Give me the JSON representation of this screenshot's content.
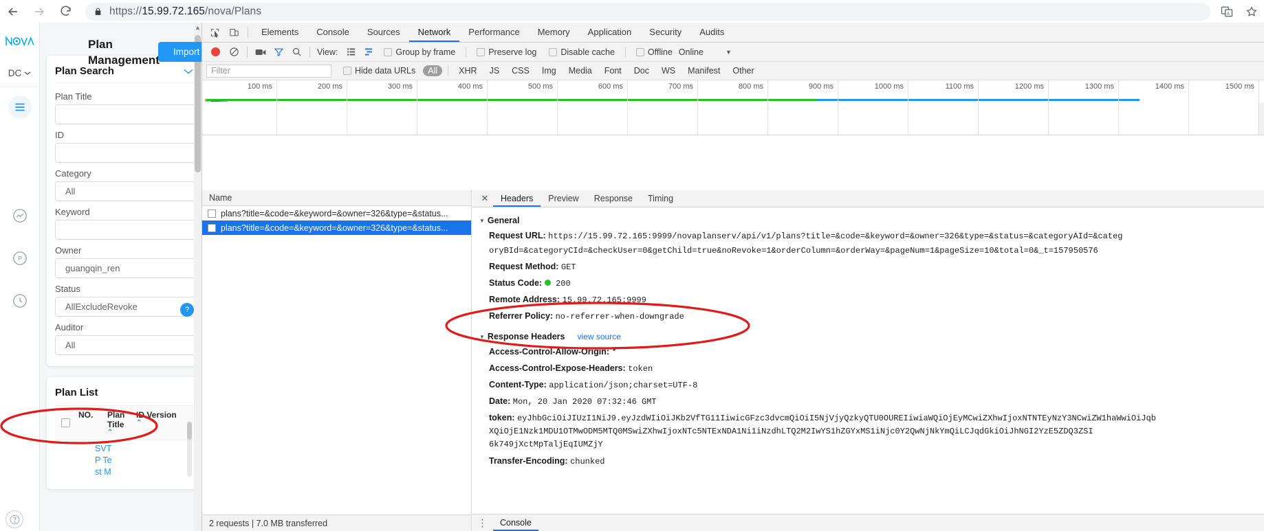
{
  "browser": {
    "back_icon": "back-arrow-icon",
    "forward_icon": "forward-arrow-icon",
    "reload_icon": "reload-icon",
    "lock_icon": "lock-icon",
    "url_scheme": "https://",
    "url_host": "15.99.72.165",
    "url_path": "/nova/Plans",
    "translate_icon": "translate-icon",
    "bookmark_icon": "star-icon"
  },
  "webpage": {
    "logo_text": "NOVA",
    "dc_selector": "DC",
    "page_heading": "Plan Management",
    "import_button": "Import",
    "search_panel": {
      "title": "Plan Search",
      "fields": [
        {
          "label": "Plan Title",
          "value": ""
        },
        {
          "label": "ID",
          "value": ""
        },
        {
          "label": "Category",
          "value": "All"
        },
        {
          "label": "Keyword",
          "value": ""
        },
        {
          "label": "Owner",
          "value": "guangqin_ren"
        },
        {
          "label": "Status",
          "value": "AllExcludeRevoke"
        },
        {
          "label": "Auditor",
          "value": "All"
        }
      ]
    },
    "plan_list": {
      "title": "Plan List",
      "columns": [
        "NO.",
        "Plan Title",
        "ID.Version"
      ],
      "rows": [
        "SVT",
        "P Te",
        "st M"
      ]
    },
    "help_badge": "?"
  },
  "devtools": {
    "inspect_icon": "inspect-element-icon",
    "device_icon": "device-toolbar-icon",
    "tabs": [
      {
        "label": "Elements",
        "active": false
      },
      {
        "label": "Console",
        "active": false
      },
      {
        "label": "Sources",
        "active": false
      },
      {
        "label": "Network",
        "active": true
      },
      {
        "label": "Performance",
        "active": false
      },
      {
        "label": "Memory",
        "active": false
      },
      {
        "label": "Application",
        "active": false
      },
      {
        "label": "Security",
        "active": false
      },
      {
        "label": "Audits",
        "active": false
      }
    ],
    "toolbar": {
      "record_icon": "record-button-icon",
      "clear_icon": "clear-icon",
      "camera_icon": "screenshot-camera-icon",
      "filter_icon": "filter-funnel-icon",
      "search_icon": "search-icon",
      "view_label": "View:",
      "list_view_icon": "list-view-icon",
      "waterfall_view_icon": "waterfall-view-icon",
      "group_by_frame": "Group by frame",
      "preserve_log": "Preserve log",
      "disable_cache": "Disable cache",
      "offline": "Offline",
      "throttling": "Online",
      "throttling_caret": "chevron-down-icon"
    },
    "filterbar": {
      "filter_placeholder": "Filter",
      "hide_data_urls": "Hide data URLs",
      "types": [
        "All",
        "XHR",
        "JS",
        "CSS",
        "Img",
        "Media",
        "Font",
        "Doc",
        "WS",
        "Manifest",
        "Other"
      ],
      "active_type": "All"
    },
    "timeline": {
      "ticks": [
        "100 ms",
        "200 ms",
        "300 ms",
        "400 ms",
        "500 ms",
        "600 ms",
        "700 ms",
        "800 ms",
        "900 ms",
        "1000 ms",
        "1100 ms",
        "1200 ms",
        "1300 ms",
        "1400 ms",
        "1500 ms"
      ],
      "green_bar_end_ms": 870,
      "blue_bar_end_ms": 1330
    },
    "requests": {
      "column_header": "Name",
      "rows": [
        {
          "name": "plans?title=&code=&keyword=&owner=326&type=&status...",
          "selected": false
        },
        {
          "name": "plans?title=&code=&keyword=&owner=326&type=&status...",
          "selected": true
        }
      ],
      "status_text": "2 requests | 7.0 MB transferred"
    },
    "detail": {
      "close_icon": "close-icon",
      "tabs": [
        {
          "label": "Headers",
          "active": true
        },
        {
          "label": "Preview",
          "active": false
        },
        {
          "label": "Response",
          "active": false
        },
        {
          "label": "Timing",
          "active": false
        }
      ],
      "general": {
        "section_label": "General",
        "request_url_label": "Request URL:",
        "request_url_line1": "https://15.99.72.165:9999/novaplanserv/api/v1/plans?title=&code=&keyword=&owner=326&type=&status=&categoryAId=&categ",
        "request_url_line2": "oryBId=&categoryCId=&checkUser=0&getChild=true&noRevoke=1&orderColumn=&orderWay=&pageNum=1&pageSize=10&total=0&_t=157950576",
        "request_method_label": "Request Method:",
        "request_method": "GET",
        "status_code_label": "Status Code:",
        "status_code": "200",
        "remote_address_label": "Remote Address:",
        "remote_address": "15.99.72.165:9999",
        "referrer_policy_label": "Referrer Policy:",
        "referrer_policy": "no-referrer-when-downgrade"
      },
      "response_headers": {
        "section_label": "Response Headers",
        "view_source": "view source",
        "items": [
          {
            "name": "Access-Control-Allow-Origin:",
            "value": "*"
          },
          {
            "name": "Access-Control-Expose-Headers:",
            "value": "token"
          },
          {
            "name": "Content-Type:",
            "value": "application/json;charset=UTF-8"
          },
          {
            "name": "Date:",
            "value": "Mon, 20 Jan 2020 07:32:46 GMT"
          }
        ],
        "token_label": "token:",
        "token_line1": "eyJhbGciOiJIUzI1NiJ9.eyJzdWIiOiJKb2VfTG11IiwicGFzc3dvcmQiOiI5NjVjyQzkyQTU0OUREIiwiaWQiOjEyMCwiZXhwIjoxNTNTEyNzY3NCwiZW1haWwiOiJqb",
        "token_line2": "XQiOjE1Nzk1MDU1OTMwODM5MTQ0MSwiZXhwIjoxNTc5NTExNDA1Ni1iNzdhLTQ2M2IwYS1hZGYxMS1iNjc0Y2QwNjNkYmQiLCJqdGkiOiJhNGI2YzE5ZDQ3ZSI",
        "token_line3": "6k749jXctMpTaljEqIUMZjY",
        "transfer_encoding_label": "Transfer-Encoding:",
        "transfer_encoding": "chunked"
      }
    },
    "drawer": {
      "menu_icon": "more-options-icon",
      "console_tab": "Console"
    }
  },
  "annotations": {
    "headers_ellipse": "red-ellipse-around-response-headers",
    "requests_ellipse": "red-ellipse-around-requests-summary"
  },
  "colors": {
    "accent_blue": "#1a73e8",
    "brand_blue": "#2196f3",
    "annotation_red": "#e01b1b",
    "status_green": "#27c127",
    "waterfall_green": "#21c521",
    "waterfall_blue": "#1a9bf0"
  }
}
